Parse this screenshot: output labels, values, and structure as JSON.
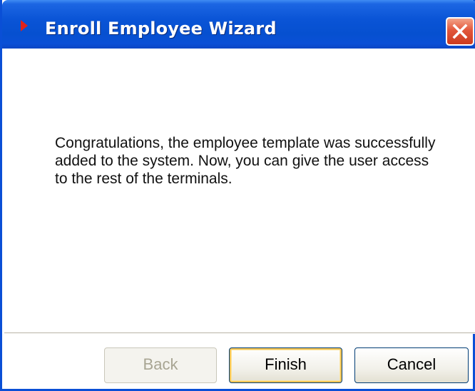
{
  "window": {
    "title": "Enroll Employee Wizard"
  },
  "icons": {
    "title_icon": "red-arrow-icon",
    "close_icon": "close-icon"
  },
  "colors": {
    "titlebar": "#0a54d6",
    "close_button": "#e2573b",
    "title_icon": "#e0221b"
  },
  "message": "Congratulations, the employee template was successfully added to the system. Now, you can give the user access to the rest of the terminals.",
  "buttons": {
    "back": "Back",
    "finish": "Finish",
    "cancel": "Cancel"
  }
}
